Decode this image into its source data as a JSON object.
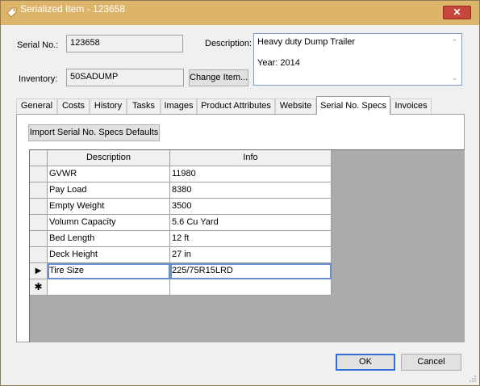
{
  "window": {
    "title": "Serialized Item - 123658",
    "close_label": "✕"
  },
  "form": {
    "serial_label": "Serial No.:",
    "serial_value": "123658",
    "inventory_label": "Inventory:",
    "inventory_value": "50SADUMP",
    "change_item_label": "Change Item...",
    "description_label": "Description:",
    "description_lines": [
      "Heavy duty Dump Trailer",
      "Year: 2014"
    ]
  },
  "tabs": [
    "General",
    "Costs",
    "History",
    "Tasks",
    "Images",
    "Product Attributes",
    "Website",
    "Serial No. Specs",
    "Invoices"
  ],
  "active_tab": "Serial No. Specs",
  "import_button_label": "Import Serial No. Specs Defaults",
  "grid": {
    "columns": [
      "Description",
      "Info"
    ],
    "rows": [
      {
        "description": "GVWR",
        "info": "11980"
      },
      {
        "description": "Pay Load",
        "info": "8380"
      },
      {
        "description": "Empty Weight",
        "info": "3500"
      },
      {
        "description": "Volumn Capacity",
        "info": "5.6 Cu Yard"
      },
      {
        "description": "Bed Length",
        "info": "12 ft"
      },
      {
        "description": "Deck Height",
        "info": "27 in"
      },
      {
        "description": "Tire Size",
        "info": "225/75R15LRD"
      }
    ],
    "current_row_marker": "▶",
    "new_row_marker": "✱",
    "selected_row_index": 6
  },
  "footer": {
    "ok_label": "OK",
    "cancel_label": "Cancel"
  },
  "colors": {
    "titlebar": "#dcb56a",
    "close": "#c7473c",
    "focus": "#2f6fd6"
  }
}
